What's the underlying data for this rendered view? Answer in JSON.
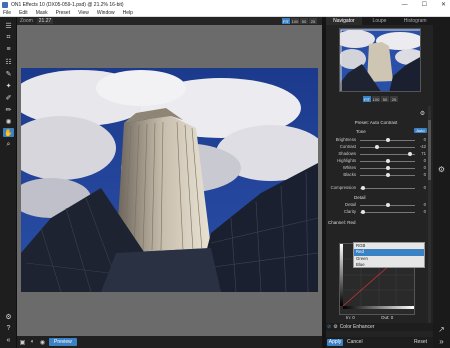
{
  "window": {
    "title": "ON1 Effects 10 (DX05-059-1.psd) @ 21.2% 16-bit)",
    "minimize_glyph": "—",
    "maximize_glyph": "☐",
    "close_glyph": "✕"
  },
  "menu": [
    "File",
    "Edit",
    "Mask",
    "Preset",
    "View",
    "Window",
    "Help"
  ],
  "canvas_toolbar": {
    "zoom_label": "Zoom",
    "zoom_value": "21.27",
    "zoom_buttons": [
      "FIT",
      "100",
      "50",
      "25"
    ]
  },
  "bottom_bar": {
    "preview_label": "Preview"
  },
  "right_panel": {
    "tabs": [
      "Navigator",
      "Loupe",
      "Histogram"
    ],
    "zoom_buttons": [
      "FIT",
      "100",
      "50",
      "25"
    ],
    "preset_label": "Preset: Auto Contrast",
    "tone": {
      "heading": "Tone",
      "auto_label": "Auto",
      "sliders": [
        {
          "label": "Brightness",
          "value": "0",
          "pos": 0.5
        },
        {
          "label": "Contrast",
          "value": "-42",
          "pos": 0.3
        },
        {
          "label": "Shadows",
          "value": "71",
          "pos": 0.9
        },
        {
          "label": "Highlights",
          "value": "0",
          "pos": 0.5
        },
        {
          "label": "Whites",
          "value": "0",
          "pos": 0.5
        },
        {
          "label": "Blacks",
          "value": "0",
          "pos": 0.5
        }
      ]
    },
    "compression": {
      "label": "Compression",
      "value": "0",
      "pos": 0.05
    },
    "detail": {
      "heading": "Detail",
      "sliders": [
        {
          "label": "Detail",
          "value": "0",
          "pos": 0.5
        },
        {
          "label": "Clarity",
          "value": "0",
          "pos": 0.05
        }
      ]
    },
    "channel": {
      "label": "Channel: Red",
      "options": [
        "RGB",
        "Red",
        "Green",
        "Blue"
      ],
      "selected": "Red",
      "in_label": "In: 0",
      "out_label": "Out: 0"
    },
    "filter_name": "Color Enhancer",
    "apply_label": "Apply",
    "cancel_label": "Cancel",
    "reset_label": "Reset"
  }
}
